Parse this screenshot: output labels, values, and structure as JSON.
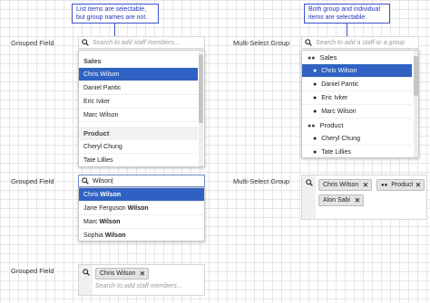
{
  "callouts": {
    "left": [
      "List items are selectable,",
      "but group names are not."
    ],
    "right": [
      "Both group and individual",
      "items are selectable."
    ]
  },
  "labels": {
    "grouped_field": "Grouped Field",
    "multi_select_group": "Multi-Select Group"
  },
  "placeholders": {
    "staff_members": "Search to add staff members...",
    "staff_or_group": "Search to add a staff or a group"
  },
  "section1_left": {
    "groups": [
      {
        "name": "Sales",
        "items": [
          "Chris Wilson",
          "Daniel Pantic",
          "Eric Ivker",
          "Marc Wilson"
        ]
      },
      {
        "name": "Product",
        "items": [
          "Cheryl Chung",
          "Tate Lillies"
        ]
      }
    ],
    "selected": "Chris Wilson"
  },
  "section1_right": {
    "rows": [
      {
        "type": "group",
        "label": "Sales",
        "icon": "group-icon"
      },
      {
        "type": "item",
        "label": "Chris Wilson",
        "icon": "person-icon",
        "selected": true
      },
      {
        "type": "item",
        "label": "Daniel Pantic",
        "icon": "person-icon"
      },
      {
        "type": "item",
        "label": "Eric Ivker",
        "icon": "person-icon"
      },
      {
        "type": "item",
        "label": "Marc Wilson",
        "icon": "person-icon"
      },
      {
        "type": "group",
        "label": "Product",
        "icon": "group-icon"
      },
      {
        "type": "item",
        "label": "Cheryl Chung",
        "icon": "person-icon"
      },
      {
        "type": "item",
        "label": "Tate Lillies",
        "icon": "person-icon"
      }
    ]
  },
  "section2_left": {
    "query": "Wilson|",
    "results": [
      {
        "pre": "Chris ",
        "match": "Wilson"
      },
      {
        "pre": "Jane Ferguson ",
        "match": "Wilson"
      },
      {
        "pre": "Marc ",
        "match": "Wilson"
      },
      {
        "pre": "Sophia ",
        "match": "Wilson"
      }
    ]
  },
  "section2_right": {
    "chips": [
      {
        "label": "Chris Wilson",
        "icon": ""
      },
      {
        "label": "Product",
        "icon": "group-icon"
      },
      {
        "label": "Alon Sabi",
        "icon": ""
      }
    ]
  },
  "section3_left": {
    "chips": [
      {
        "label": "Chris Wilson"
      }
    ]
  },
  "colors": {
    "selection": "#2f62c2",
    "callout_border": "#3a53c9",
    "callout_text": "#2336b6"
  }
}
